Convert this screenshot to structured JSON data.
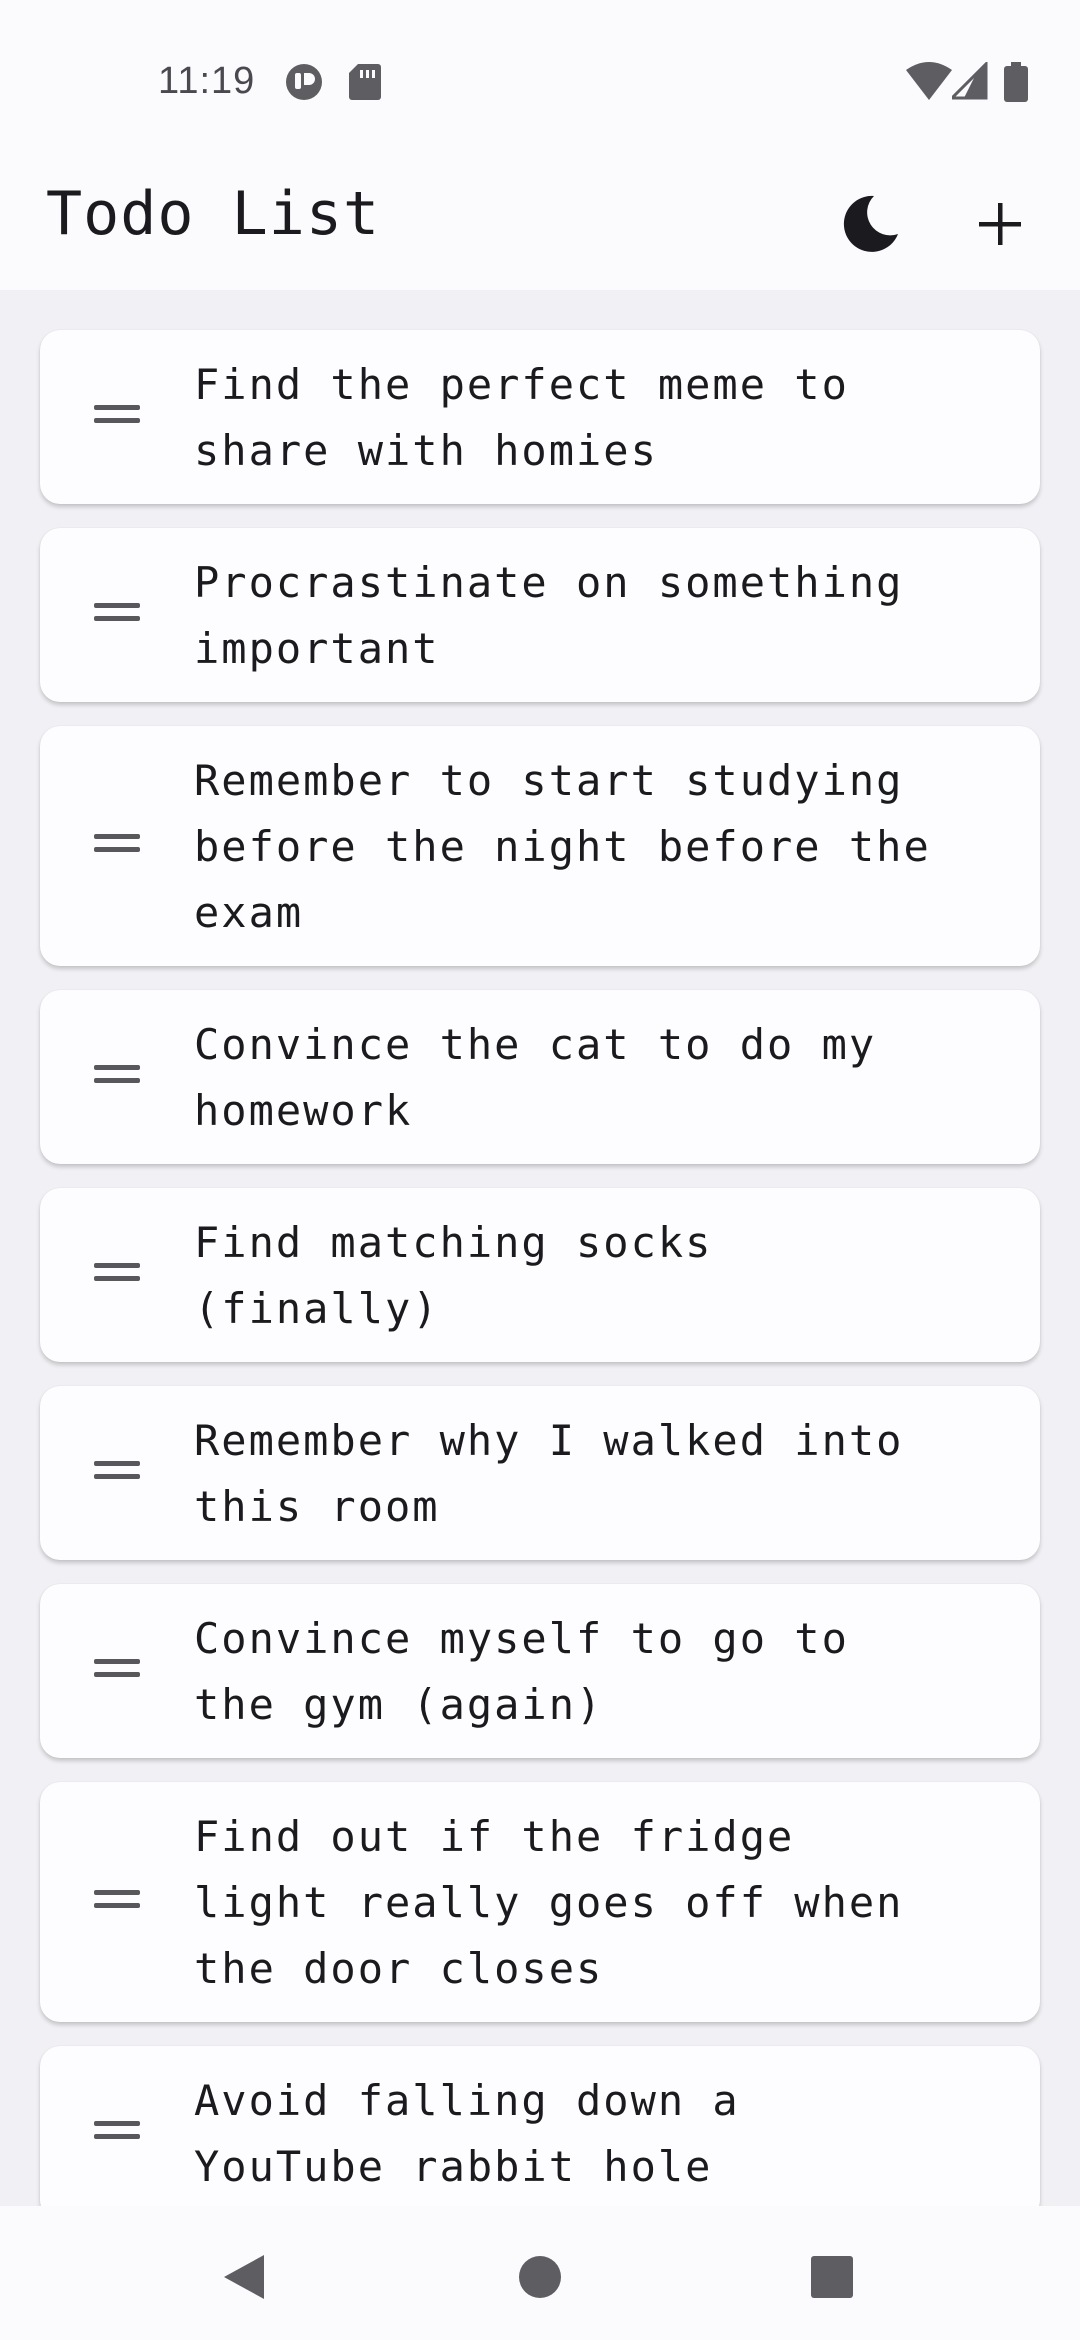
{
  "status_bar": {
    "time": "11:19",
    "icons": [
      "app-notification-icon",
      "sd-card-icon",
      "wifi-icon",
      "signal-icon",
      "battery-icon"
    ]
  },
  "app_bar": {
    "title": "Todo List",
    "actions": [
      "dark-mode-icon",
      "add-icon"
    ]
  },
  "todos": [
    {
      "text": "Find the perfect meme to\nshare with homies"
    },
    {
      "text": "Procrastinate on something\nimportant"
    },
    {
      "text": "Remember to start studying\nbefore the night before the\nexam"
    },
    {
      "text": "Convince the cat to do my\nhomework"
    },
    {
      "text": "Find matching socks\n(finally)"
    },
    {
      "text": "Remember why I walked into\nthis room"
    },
    {
      "text": "Convince myself to go to\nthe gym (again)"
    },
    {
      "text": "Find out if the fridge\nlight really goes off when\nthe door closes"
    },
    {
      "text": "Avoid falling down a\nYouTube rabbit hole"
    }
  ],
  "nav_bar": {
    "buttons": [
      "back-icon",
      "home-icon",
      "recents-icon"
    ]
  },
  "colors": {
    "background": "#f1f0f4",
    "surface": "#fdfdff",
    "text": "#1b1b1f",
    "icon": "#57575c"
  }
}
